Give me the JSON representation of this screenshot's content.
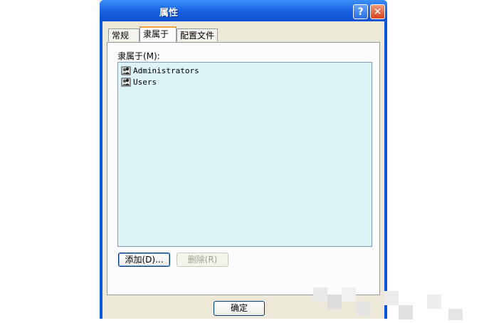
{
  "window": {
    "title": "属性"
  },
  "titlebar": {
    "help_label": "?",
    "close_label": "✕"
  },
  "tabs": [
    {
      "label": "常规"
    },
    {
      "label": "隶属于"
    },
    {
      "label": "配置文件"
    }
  ],
  "member_of": {
    "label": "隶属于(M):",
    "items": [
      {
        "name": "Administrators",
        "icon": "group-icon"
      },
      {
        "name": "Users",
        "icon": "group-icon"
      }
    ]
  },
  "buttons": {
    "add": "添加(D)...",
    "remove": "删除(R)",
    "ok": "确定"
  }
}
